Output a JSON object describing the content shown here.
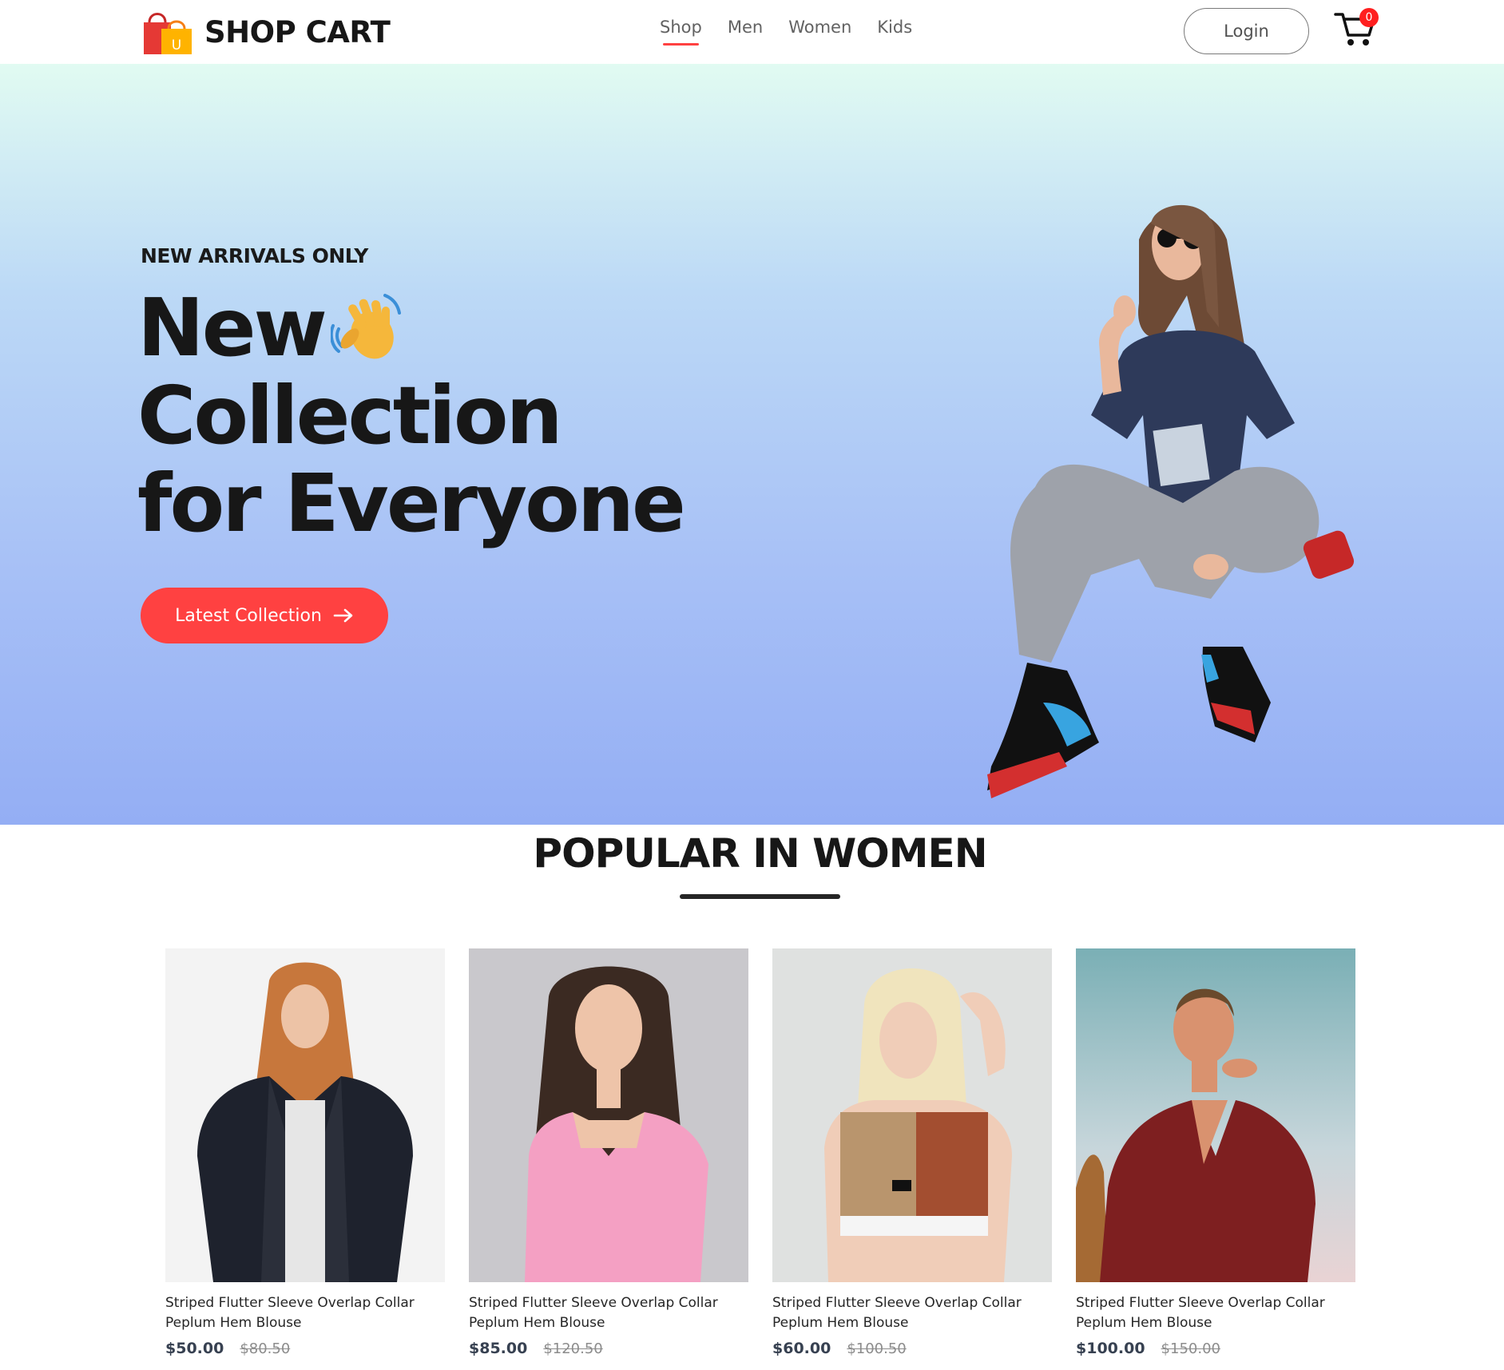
{
  "brand": {
    "name": "SHOP CART",
    "bag_letter": "U"
  },
  "nav": {
    "items": [
      {
        "label": "Shop",
        "active": true
      },
      {
        "label": "Men",
        "active": false
      },
      {
        "label": "Women",
        "active": false
      },
      {
        "label": "Kids",
        "active": false
      }
    ]
  },
  "header": {
    "login_label": "Login",
    "cart_count": "0",
    "cart_icon": "cart-icon"
  },
  "hero": {
    "tagline": "NEW ARRIVALS ONLY",
    "line1": "New",
    "line2": "Collection",
    "line3": "for Everyone",
    "cta_label": "Latest Collection",
    "cta_icon": "arrow-right-icon",
    "emoji_icon": "waving-hand-icon"
  },
  "popular": {
    "title": "POPULAR IN WOMEN",
    "products": [
      {
        "name_line1": "Striped Flutter Sleeve Overlap Collar",
        "name_line2": "Peplum Hem Blouse",
        "new_price": "$50.00",
        "old_price": "$80.50"
      },
      {
        "name_line1": "Striped Flutter Sleeve Overlap Collar",
        "name_line2": "Peplum Hem Blouse",
        "new_price": "$85.00",
        "old_price": "$120.50"
      },
      {
        "name_line1": "Striped Flutter Sleeve Overlap Collar",
        "name_line2": "Peplum Hem Blouse",
        "new_price": "$60.00",
        "old_price": "$100.50"
      },
      {
        "name_line1": "Striped Flutter Sleeve Overlap Collar",
        "name_line2": "Peplum Hem Blouse",
        "new_price": "$100.00",
        "old_price": "$150.00"
      }
    ]
  },
  "colors": {
    "accent": "#ff4141",
    "hero_top": "#e1fbf2",
    "hero_bottom": "#94aef4",
    "text_dark": "#171717"
  }
}
